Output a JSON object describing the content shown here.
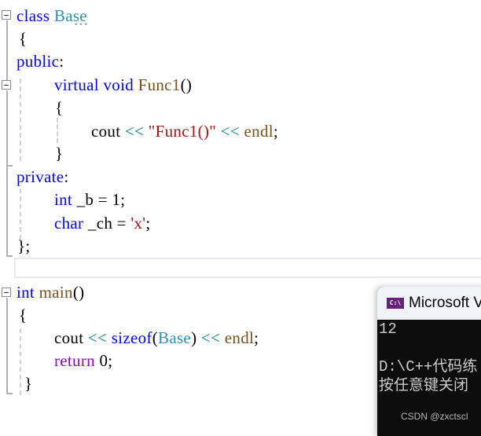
{
  "editor": {
    "lines": [
      {
        "tokens": [
          "class",
          " ",
          "Base"
        ]
      },
      {
        "tokens": [
          "{"
        ]
      },
      {
        "tokens": [
          "public",
          ":"
        ]
      },
      {
        "tokens": [
          "virtual",
          " ",
          "void",
          " ",
          "Func1",
          "()"
        ]
      },
      {
        "tokens": [
          "{"
        ]
      },
      {
        "tokens": [
          "cout",
          " ",
          "<<",
          " ",
          "\"Func1()\"",
          " ",
          "<<",
          " ",
          "endl",
          ";"
        ]
      },
      {
        "tokens": [
          "}"
        ]
      },
      {
        "tokens": [
          "private",
          ":"
        ]
      },
      {
        "tokens": [
          "int",
          " _b = 1;"
        ]
      },
      {
        "tokens": [
          "char",
          " _ch = ",
          "'x'",
          ";"
        ]
      },
      {
        "tokens": [
          "};"
        ]
      },
      {
        "tokens": [
          "int",
          " ",
          "main",
          "()"
        ]
      },
      {
        "tokens": [
          "{"
        ]
      },
      {
        "tokens": [
          "cout",
          " ",
          "<<",
          " ",
          "sizeof",
          "(",
          "Base",
          ")",
          " ",
          "<<",
          " ",
          "endl",
          ";"
        ]
      },
      {
        "tokens": [
          "return",
          " 0;"
        ]
      },
      {
        "tokens": [
          "}"
        ]
      }
    ]
  },
  "console": {
    "title": "Microsoft V",
    "icon_label": "C:\\",
    "output": [
      "12",
      "",
      "D:\\C++代码练",
      "按任意键关闭"
    ],
    "watermark": "CSDN @zxctscl"
  }
}
